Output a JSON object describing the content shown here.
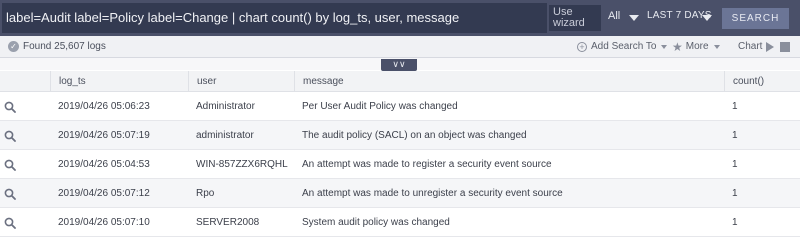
{
  "query": {
    "text": "label=Audit label=Policy label=Change | chart count() by log_ts, user, message",
    "wizard_label": "Use wizard",
    "scope": "All",
    "time_range": "LAST 7 DAYS",
    "search_label": "SEARCH"
  },
  "toolbar": {
    "found": "Found 25,607 logs",
    "add_search": "Add Search To",
    "more": "More",
    "chart": "Chart"
  },
  "table": {
    "columns": [
      "log_ts",
      "user",
      "message",
      "count()"
    ],
    "rows": [
      {
        "log_ts": "2019/04/26 05:06:23",
        "user": "Administrator",
        "message": "Per User Audit Policy was changed",
        "count": "1"
      },
      {
        "log_ts": "2019/04/26 05:07:19",
        "user": "administrator",
        "message": "The audit policy (SACL) on an object was changed",
        "count": "1"
      },
      {
        "log_ts": "2019/04/26 05:04:53",
        "user": "WIN-857ZZX6RQHL",
        "message": "An attempt was made to register a security event source",
        "count": "1"
      },
      {
        "log_ts": "2019/04/26 05:07:12",
        "user": "Rpo",
        "message": "An attempt was made to unregister a security event source",
        "count": "1"
      },
      {
        "log_ts": "2019/04/26 05:07:10",
        "user": "SERVER2008",
        "message": "System audit policy was changed",
        "count": "1"
      }
    ]
  },
  "icons": {
    "row_action": "magnifier-icon",
    "found_status": "check-circle-icon",
    "add": "plus-circle-icon",
    "more": "star-icon",
    "run": "play-icon",
    "stop": "stop-icon",
    "collapse": "double-chevron-down-icon"
  },
  "colors": {
    "header_bg": "#4a5069",
    "input_bg": "#333a51",
    "search_button": "#6b7596"
  }
}
